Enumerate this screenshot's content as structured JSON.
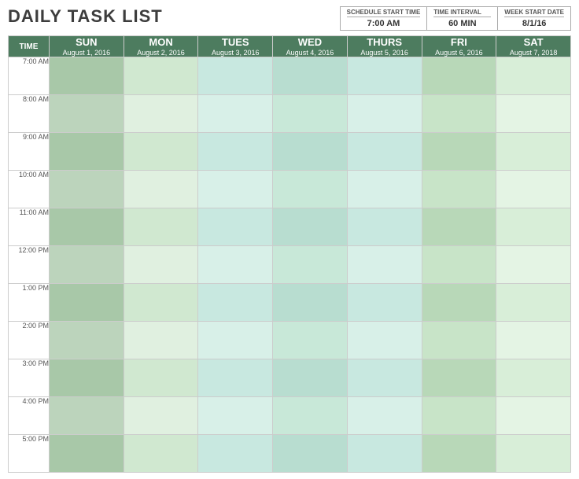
{
  "title": "DAILY TASK LIST",
  "meta": {
    "schedule_start_time": {
      "label": "SCHEDULE START TIME",
      "value": "7:00 AM"
    },
    "time_interval": {
      "label": "TIME INTERVAL",
      "value": "60 MIN"
    },
    "week_start_date": {
      "label": "WEEK START DATE",
      "value": "8/1/16"
    }
  },
  "columns": {
    "time_label": "TIME",
    "days": [
      {
        "name": "SUN",
        "date": "August 1, 2016"
      },
      {
        "name": "MON",
        "date": "August 2, 2016"
      },
      {
        "name": "TUES",
        "date": "August 3, 2016"
      },
      {
        "name": "WED",
        "date": "August 4, 2016"
      },
      {
        "name": "THURS",
        "date": "August 5, 2016"
      },
      {
        "name": "FRI",
        "date": "August 6, 2016"
      },
      {
        "name": "SAT",
        "date": "August 7, 2018"
      }
    ]
  },
  "time_slots": [
    "7:00 AM",
    "8:00 AM",
    "9:00 AM",
    "10:00 AM",
    "11:00 AM",
    "12:00 PM",
    "1:00 PM",
    "2:00 PM",
    "3:00 PM",
    "4:00 PM",
    "5:00 PM"
  ]
}
